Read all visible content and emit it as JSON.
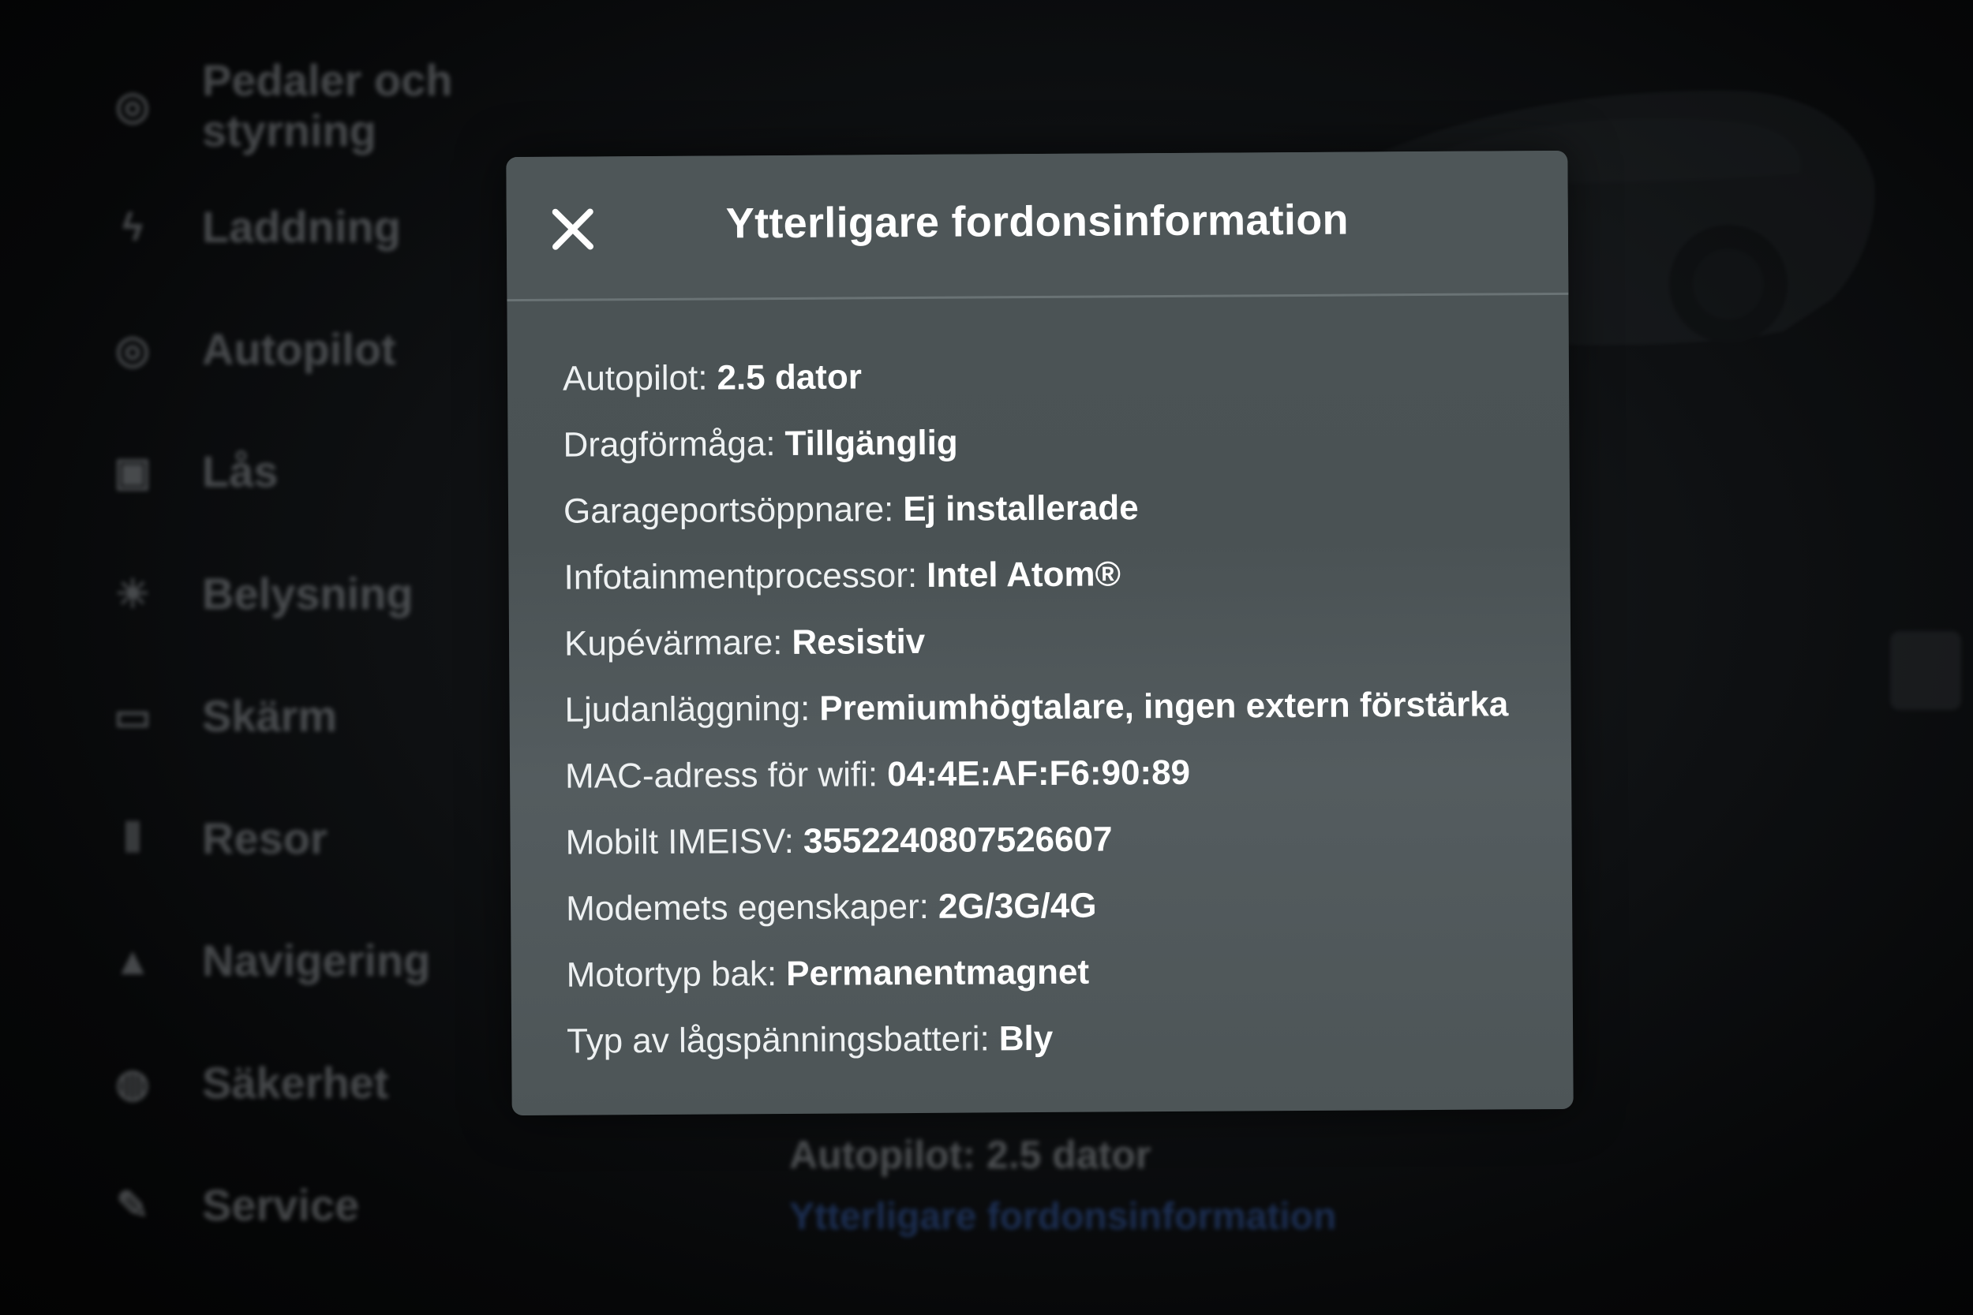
{
  "background": {
    "sidebar_items": [
      {
        "icon": "steering-wheel-icon",
        "label": "Pedaler och styrning"
      },
      {
        "icon": "lightning-icon",
        "label": "Laddning"
      },
      {
        "icon": "steering-wheel-icon",
        "label": "Autopilot"
      },
      {
        "icon": "lock-icon",
        "label": "Lås"
      },
      {
        "icon": "light-bulb-icon",
        "label": "Belysning"
      },
      {
        "icon": "display-icon",
        "label": "Skärm"
      },
      {
        "icon": "trips-icon",
        "label": "Resor"
      },
      {
        "icon": "navigation-arrow-icon",
        "label": "Navigering"
      },
      {
        "icon": "shield-icon",
        "label": "Säkerhet"
      },
      {
        "icon": "wrench-icon",
        "label": "Service"
      }
    ],
    "info_line": "Autopilot: 2.5 dator",
    "info_link": "Ytterligare fordonsinformation"
  },
  "modal": {
    "title": "Ytterligare fordonsinformation",
    "close_icon": "close-icon",
    "items": [
      {
        "label": "Autopilot:",
        "value": "2.5 dator"
      },
      {
        "label": "Dragförmåga:",
        "value": "Tillgänglig"
      },
      {
        "label": "Garageportsöppnare:",
        "value": "Ej installerade"
      },
      {
        "label": "Infotainmentprocessor:",
        "value": "Intel Atom®"
      },
      {
        "label": "Kupévärmare:",
        "value": "Resistiv"
      },
      {
        "label": "Ljudanläggning:",
        "value": "Premiumhögtalare, ingen extern förstärka"
      },
      {
        "label": "MAC-adress för wifi:",
        "value": "04:4E:AF:F6:90:89"
      },
      {
        "label": "Mobilt IMEISV:",
        "value": "3552240807526607"
      },
      {
        "label": "Modemets egenskaper:",
        "value": "2G/3G/4G"
      },
      {
        "label": "Motortyp bak:",
        "value": "Permanentmagnet"
      },
      {
        "label": "Typ av lågspänningsbatteri:",
        "value": "Bly"
      }
    ]
  },
  "colors": {
    "modal_bg": "#4c5456",
    "text": "#ffffff",
    "link_blue": "#3e6fd0",
    "screen_bg": "#050607"
  }
}
